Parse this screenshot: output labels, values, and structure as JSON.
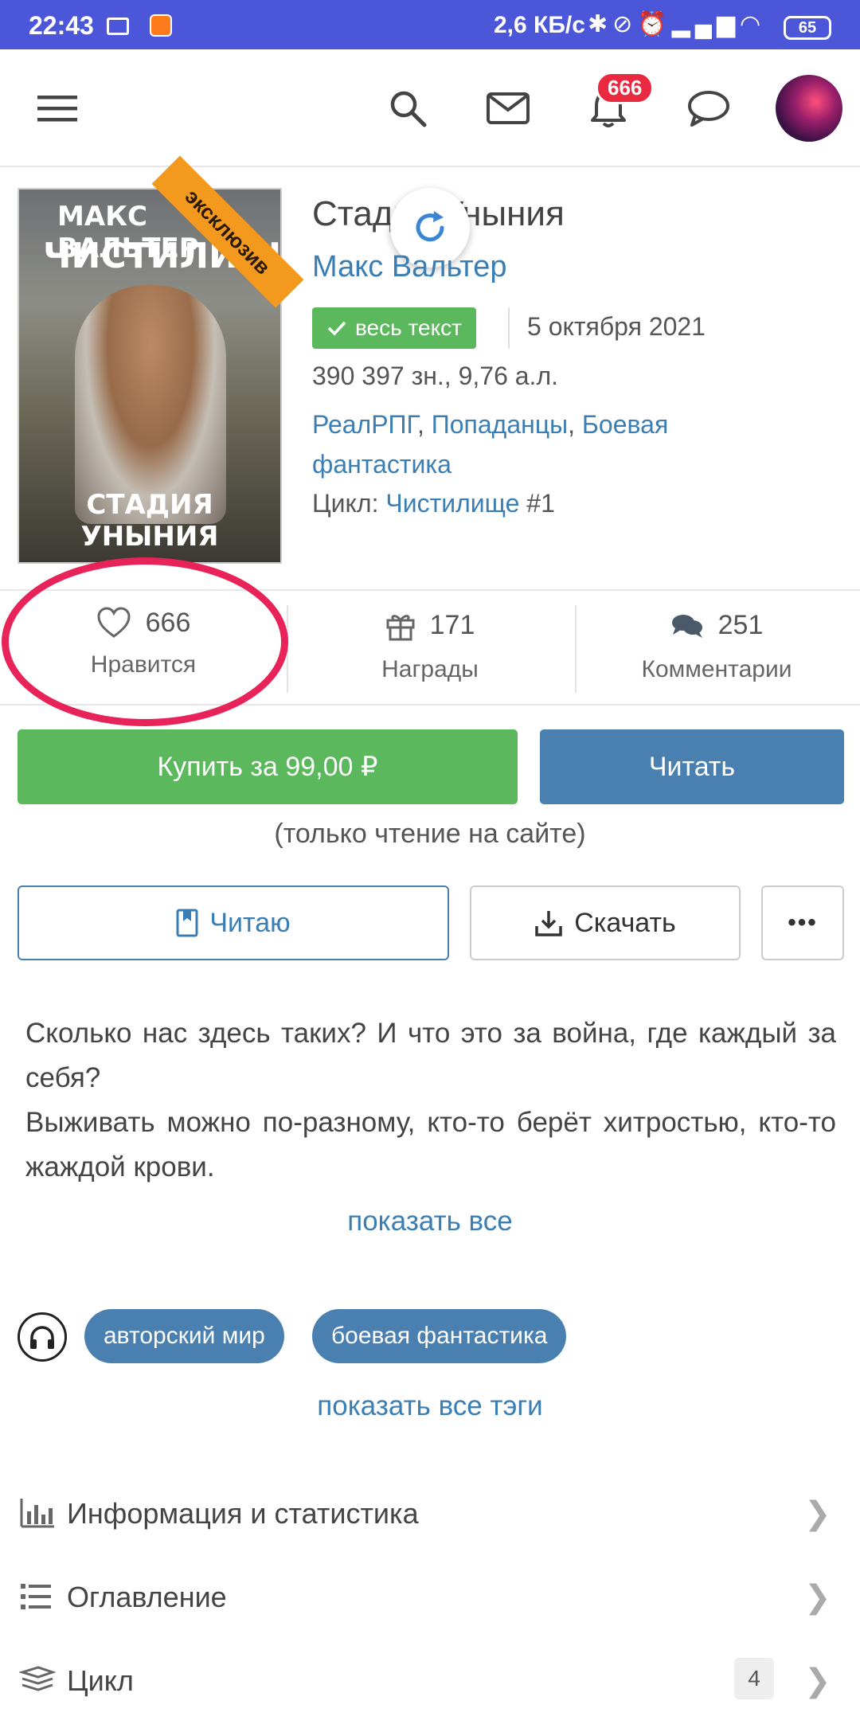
{
  "status_bar": {
    "time": "22:43",
    "speed": "2,6 КБ/с",
    "battery": "65"
  },
  "header": {
    "notifications_count": "666"
  },
  "book": {
    "cover": {
      "author_text": "МАКС ВАЛЬТЕР",
      "title_text": "ЧИСТИЛИЩЕ",
      "subtitle_text": "СТАДИЯ УНЫНИЯ",
      "ribbon": "эксклюзив"
    },
    "title": "Стадия Уныния",
    "author": "Макс Вальтер",
    "status_tag": "весь текст",
    "date": "5 октября 2021",
    "size": "390 397 зн., 9,76 а.л.",
    "genres": [
      "РеалРПГ",
      "Попаданцы",
      "Боевая фантастика"
    ],
    "cycle_label": "Цикл:",
    "cycle_name": "Чистилище",
    "cycle_number": "#1"
  },
  "stats": [
    {
      "value": "666",
      "label": "Нравится",
      "icon": "heart-icon"
    },
    {
      "value": "171",
      "label": "Награды",
      "icon": "gift-icon"
    },
    {
      "value": "251",
      "label": "Комментарии",
      "icon": "comments-icon"
    }
  ],
  "actions": {
    "buy_label": "Купить за 99,00 ₽",
    "read_label": "Читать",
    "note": "(только чтение на сайте)",
    "reading_label": "Читаю",
    "download_label": "Скачать",
    "more_label": "•••"
  },
  "annotation": {
    "line1": "Сколько нас здесь таких? И что это за война, где каждый за себя?",
    "line2": "Выживать можно по-разному, кто-то берёт хитростью, кто-то жаждой крови.",
    "show_all": "показать все"
  },
  "tags": {
    "items": [
      "авторский мир",
      "боевая фантастика"
    ],
    "show_all": "показать все тэги"
  },
  "info_list": [
    {
      "label": "Информация и статистика",
      "icon": "bar-chart-icon"
    },
    {
      "label": "Оглавление",
      "icon": "list-icon"
    },
    {
      "label": "Цикл",
      "icon": "books-stack-icon",
      "count": "4"
    }
  ],
  "colors": {
    "status_bar": "#4b57d8",
    "green": "#5cb85c",
    "blue_button": "#4a80b0",
    "link": "#3a7eb4",
    "badge": "#e8293f",
    "highlight_circle": "#e8235a"
  }
}
